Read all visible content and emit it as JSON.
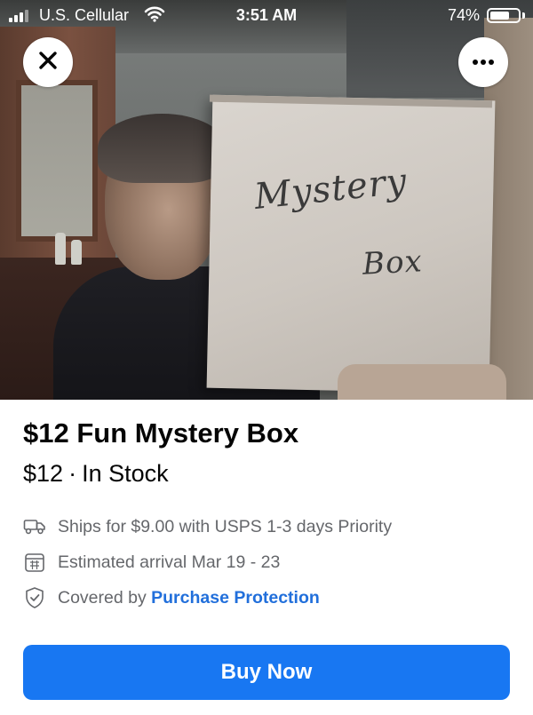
{
  "status_bar": {
    "carrier": "U.S. Cellular",
    "time": "3:51 AM",
    "battery_percent": "74%",
    "battery_level": 0.74
  },
  "photo": {
    "box_text_line1": "Mystery",
    "box_text_line2": "Box"
  },
  "listing": {
    "title": "$12 Fun Mystery Box",
    "price": "$12",
    "separator": "·",
    "stock": "In Stock",
    "shipping": "Ships for $9.00 with USPS 1-3 days Priority",
    "arrival": "Estimated arrival Mar 19 - 23",
    "protection_prefix": "Covered by",
    "protection_link": "Purchase Protection"
  },
  "actions": {
    "buy_label": "Buy Now"
  },
  "icons": {
    "close": "close-icon",
    "more": "more-icon",
    "truck": "truck-icon",
    "calendar": "calendar-icon",
    "shield": "shield-check-icon"
  },
  "colors": {
    "accent": "#1877f2",
    "link": "#216fdb",
    "secondary_text": "#65676b",
    "primary_text": "#050505"
  }
}
